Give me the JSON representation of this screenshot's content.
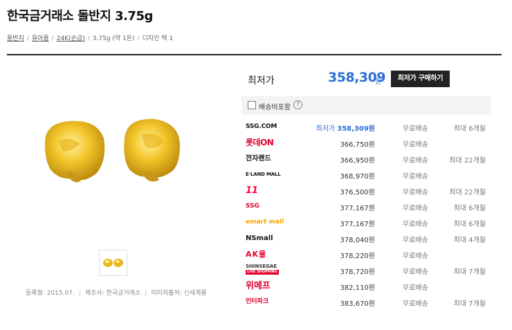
{
  "header": {
    "title": "한국금거래소 돌반지 3.75g",
    "breadcrumbs": [
      {
        "label": "돌반지",
        "link": true
      },
      {
        "label": "유아용",
        "link": true
      },
      {
        "label": "24K(순금)",
        "link": true
      },
      {
        "label": "3.75g (약 1돈)",
        "link": false
      },
      {
        "label": "디자인 택 1",
        "link": false
      }
    ]
  },
  "product": {
    "meta": {
      "registered": "등록월: 2015.07.",
      "maker": "제조사: 한국금거래소",
      "image_source": "이미지출처: 신세계몰"
    }
  },
  "price_panel": {
    "lowest_label": "최저가",
    "lowest_price": "358,309",
    "won": "원",
    "buy_button": "최저가 구매하기",
    "include_shipping_label": "배송비포함",
    "help_icon": "?",
    "include_shipping_checked": false
  },
  "sellers": [
    {
      "logo": "SSG.COM",
      "best_label": "최저가",
      "price": "358,309원",
      "shipping": "무료배송",
      "installment": "최대 6개월",
      "best": true
    },
    {
      "logo": "롯데ON",
      "price": "366,750원",
      "shipping": "무료배송",
      "installment": ""
    },
    {
      "logo": "전자랜드",
      "price": "366,950원",
      "shipping": "무료배송",
      "installment": "최대 22개월"
    },
    {
      "logo": "E·LAND MALL",
      "price": "368,970원",
      "shipping": "무료배송",
      "installment": ""
    },
    {
      "logo": "11",
      "price": "376,500원",
      "shipping": "무료배송",
      "installment": "최대 22개월"
    },
    {
      "logo": "SSG",
      "price": "377,167원",
      "shipping": "무료배송",
      "installment": "최대 6개월"
    },
    {
      "logo": "emart mall",
      "price": "377,167원",
      "shipping": "무료배송",
      "installment": "최대 6개월"
    },
    {
      "logo": "NSmall",
      "price": "378,040원",
      "shipping": "무료배송",
      "installment": "최대 4개월"
    },
    {
      "logo": "AK몰",
      "price": "378,220원",
      "shipping": "무료배송",
      "installment": ""
    },
    {
      "logo": "SHINSEGAE",
      "logo_sub": "LIVE SHOPPING",
      "price": "378,720원",
      "shipping": "무료배송",
      "installment": "최대 7개월"
    },
    {
      "logo": "위메프",
      "price": "382,110원",
      "shipping": "무료배송",
      "installment": ""
    },
    {
      "logo": "인터파크",
      "price": "383,670원",
      "shipping": "무료배송",
      "installment": "최대 7개월"
    }
  ],
  "colors": {
    "accent_blue": "#2d6fd6",
    "gold": "#e8b820",
    "button_bg": "#222222"
  }
}
